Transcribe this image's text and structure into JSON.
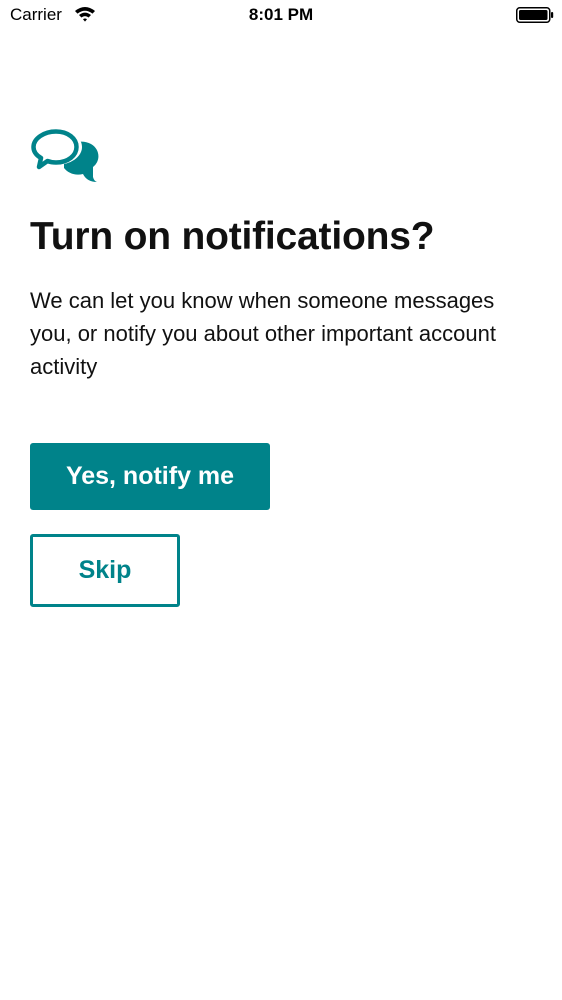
{
  "status_bar": {
    "carrier": "Carrier",
    "time": "8:01 PM",
    "wifi_icon": "wifi-icon",
    "battery_icon": "battery-full-icon"
  },
  "header": {
    "icon": "chat-bubbles-icon",
    "title": "Turn on notifications?"
  },
  "body": {
    "description": "We can let you know when someone messages you, or notify you about other important account activity"
  },
  "actions": {
    "primary_label": "Yes, notify me",
    "secondary_label": "Skip"
  },
  "colors": {
    "accent": "#00838a",
    "text": "#111111",
    "background": "#ffffff"
  }
}
